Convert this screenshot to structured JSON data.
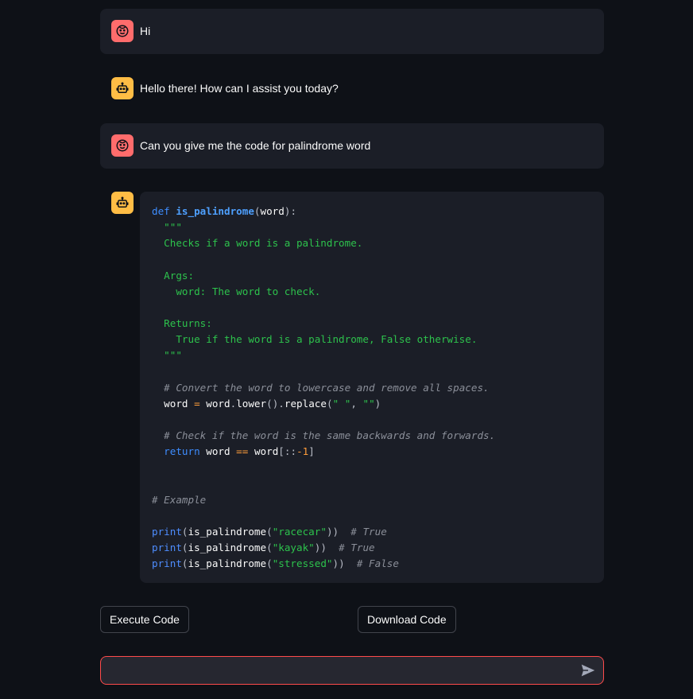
{
  "messages": [
    {
      "role": "user",
      "text": "Hi"
    },
    {
      "role": "assistant",
      "text": "Hello there! How can I assist you today?"
    },
    {
      "role": "user",
      "text": "Can you give me the code for palindrome word"
    }
  ],
  "code": {
    "lines": [
      "def is_palindrome(word):",
      "  \"\"\"",
      "  Checks if a word is a palindrome.",
      "",
      "  Args:",
      "    word: The word to check.",
      "",
      "  Returns:",
      "    True if the word is a palindrome, False otherwise.",
      "  \"\"\"",
      "",
      "  # Convert the word to lowercase and remove all spaces.",
      "  word = word.lower().replace(\" \", \"\")",
      "",
      "  # Check if the word is the same backwards and forwards.",
      "  return word == word[::-1]",
      "",
      "",
      "# Example",
      "",
      "print(is_palindrome(\"racecar\"))  # True",
      "print(is_palindrome(\"kayak\"))  # True",
      "print(is_palindrome(\"stressed\"))  # False"
    ]
  },
  "buttons": {
    "execute_label": "Execute Code",
    "download_label": "Download Code"
  },
  "chat_input": {
    "value": "",
    "placeholder": ""
  },
  "colors": {
    "background": "#0e1117",
    "user_avatar": "#ff6c6c",
    "assistant_avatar": "#ffbd45",
    "input_border": "#ff4b4b"
  }
}
